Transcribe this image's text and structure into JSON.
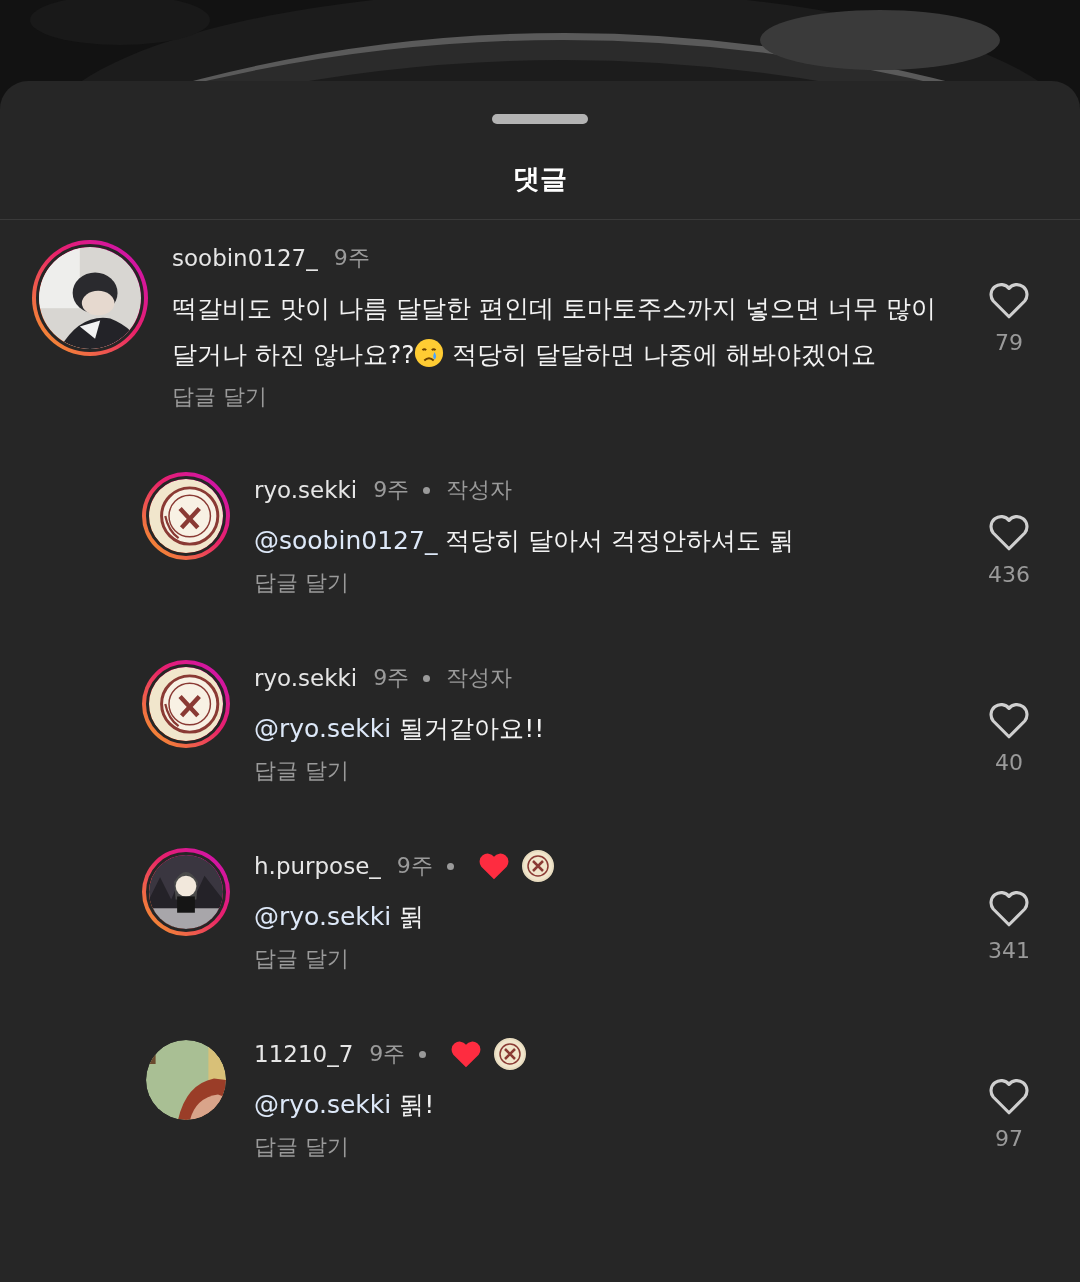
{
  "sheet": {
    "title": "댓글"
  },
  "comments": [
    {
      "username": "soobin0127_",
      "time": "9주",
      "story_ring": true,
      "liked_by_creator": false,
      "body": [
        {
          "kind": "text",
          "text": "떡갈비도 맛이 나름 달달한 편인데 토마토주스까지 넣으면 너무 많이 달거나 하진 않나요??"
        },
        {
          "kind": "emoji"
        },
        {
          "kind": "text",
          "text": " 적당히 달달하면 나중에 해봐야겠어요"
        }
      ],
      "reply": "답글 달기",
      "likes": "79",
      "children": [
        {
          "username": "ryo.sekki",
          "time": "9주",
          "story_ring": true,
          "author_label": "작성자",
          "liked_by_creator": false,
          "mention": "@soobin0127_",
          "body": [
            {
              "kind": "text",
              "text": " 적당히 달아서 걱정안하셔도 됡"
            }
          ],
          "reply": "답글 달기",
          "likes": "436"
        },
        {
          "username": "ryo.sekki",
          "time": "9주",
          "story_ring": true,
          "author_label": "작성자",
          "liked_by_creator": false,
          "mention": "@ryo.sekki",
          "body": [
            {
              "kind": "text",
              "text": " 될거같아요!!"
            }
          ],
          "reply": "답글 달기",
          "likes": "40"
        },
        {
          "username": "h.purpose_",
          "time": "9주",
          "story_ring": true,
          "liked_by_creator": true,
          "mention": "@ryo.sekki",
          "body": [
            {
              "kind": "text",
              "text": " 됡"
            }
          ],
          "reply": "답글 달기",
          "likes": "341"
        },
        {
          "username": "11210_7",
          "time": "9주",
          "story_ring": false,
          "liked_by_creator": true,
          "mention": "@ryo.sekki",
          "body": [
            {
              "kind": "text",
              "text": " 됡!"
            }
          ],
          "reply": "답글 달기",
          "likes": "97"
        }
      ]
    }
  ]
}
